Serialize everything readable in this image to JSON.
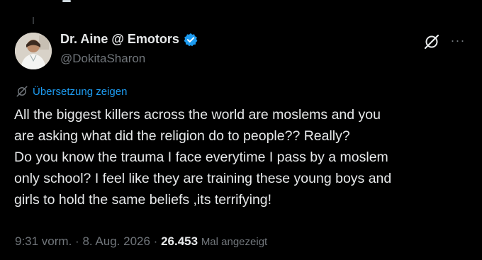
{
  "user": {
    "display_name": "Dr. Aine @ Emotors",
    "handle": "@DokitaSharon",
    "verified": true
  },
  "icons": {
    "verified": "verified-badge-icon",
    "grok": "grok-icon",
    "more": "more-dots-icon",
    "translate": "translate-icon"
  },
  "colors": {
    "background": "#000000",
    "text": "#e7e9ea",
    "muted": "#71767b",
    "accent": "#1d9bf0"
  },
  "translate_label": "Übersetzung zeigen",
  "tweet": {
    "lines": [
      "All the biggest killers across the world are moslems and you",
      "are asking what did the religion do to people?? Really?",
      "Do you know the trauma I face everytime I pass by a moslem",
      "only school? I feel like they are training these young boys and",
      "girls to hold the same beliefs ,its terrifying!"
    ]
  },
  "meta": {
    "time": "9:31 vorm.",
    "separator": "·",
    "date": "8. Aug. 2026",
    "views_count": "26.453",
    "views_label": "Mal angezeigt"
  }
}
